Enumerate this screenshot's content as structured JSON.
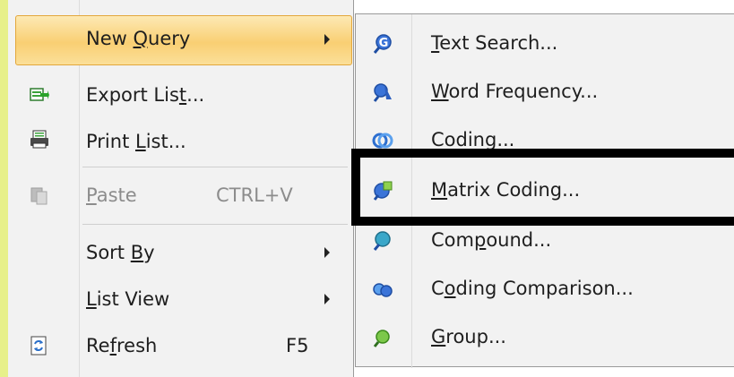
{
  "colors": {
    "menu_background": "#f2f2f2",
    "highlight": "#f9cf73",
    "highlight_border": "#e3a73b",
    "disabled_text": "#8c8c8c",
    "annotation_box": "#000000",
    "left_strip": "#e7f08a"
  },
  "left_menu": {
    "items": [
      {
        "label_pre": "New ",
        "label_u": "Q",
        "label_post": "uery",
        "has_submenu": true,
        "state": "highlighted"
      },
      {
        "icon": "export-list-icon",
        "label_pre": "Export Lis",
        "label_u": "t",
        "label_post": "...",
        "has_submenu": false
      },
      {
        "icon": "print-list-icon",
        "label_pre": "Print ",
        "label_u": "L",
        "label_post": "ist...",
        "has_submenu": false
      },
      {
        "icon": "paste-icon",
        "label_pre": "",
        "label_u": "P",
        "label_post": "aste",
        "shortcut": "CTRL+V",
        "state": "disabled"
      },
      {
        "label_pre": "Sort ",
        "label_u": "B",
        "label_post": "y",
        "has_submenu": true
      },
      {
        "label_pre": "",
        "label_u": "L",
        "label_post": "ist View",
        "has_submenu": true
      },
      {
        "icon": "refresh-icon",
        "label_pre": "Re",
        "label_u": "f",
        "label_post": "resh",
        "shortcut": "F5"
      }
    ]
  },
  "submenu": {
    "items": [
      {
        "icon": "text-search-icon",
        "label_pre": "",
        "label_u": "T",
        "label_post": "ext Search..."
      },
      {
        "icon": "word-frequency-icon",
        "label_pre": "",
        "label_u": "W",
        "label_post": "ord Frequency..."
      },
      {
        "icon": "coding-icon",
        "label_pre": "Coding",
        "label_u": "",
        "label_post": "..."
      },
      {
        "icon": "matrix-coding-icon",
        "label_pre": "",
        "label_u": "M",
        "label_post": "atrix Coding..."
      },
      {
        "icon": "compound-icon",
        "label_pre": "Com",
        "label_u": "p",
        "label_post": "ound..."
      },
      {
        "icon": "coding-comparison-icon",
        "label_pre": "C",
        "label_u": "o",
        "label_post": "ding Comparison..."
      },
      {
        "icon": "group-icon",
        "label_pre": "",
        "label_u": "G",
        "label_post": "roup..."
      }
    ]
  }
}
